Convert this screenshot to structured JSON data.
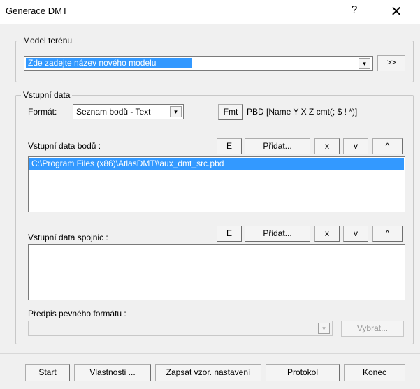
{
  "window": {
    "title": "Generace DMT",
    "help": "?",
    "close": "✕"
  },
  "model_group": {
    "legend": "Model terénu",
    "input_value": "Zde zadejte název nového modelu",
    "browse_label": ">>"
  },
  "input_group": {
    "legend": "Vstupní data",
    "format_label": "Formát:",
    "format_value": "Seznam bodů - Text",
    "fmt_button": "Fmt",
    "format_desc": "PBD [Name Y X Z cmt(; $ ! *)]",
    "points_label": "Vstupní data bodů :",
    "points_files": [
      "C:\\Program Files (x86)\\AtlasDMT\\\\aux_dmt_src.pbd"
    ],
    "lines_label": "Vstupní data spojnic :",
    "btn_e": "E",
    "btn_add": "Přidat...",
    "btn_x": "x",
    "btn_down": "v",
    "btn_up": "^",
    "fixed_format_label": "Předpis pevného formátu :",
    "fixed_format_value": "",
    "select_label": "Vybrat..."
  },
  "footer": {
    "start": "Start",
    "properties": "Vlastnosti ...",
    "save_template": "Zapsat vzor. nastavení",
    "protocol": "Protokol",
    "end": "Konec"
  },
  "icons": {
    "dropdown": "▾"
  }
}
